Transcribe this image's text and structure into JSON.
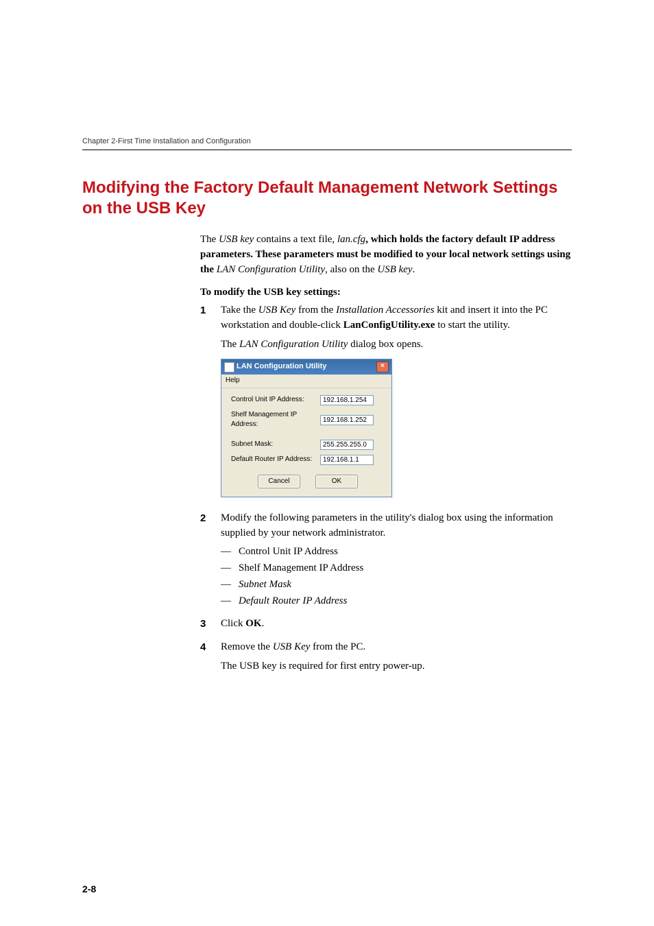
{
  "header": {
    "chapter": "Chapter 2-First Time Installation and Configuration"
  },
  "section": {
    "title": "Modifying the Factory Default Management Network Settings on the USB Key"
  },
  "intro": {
    "p1a": "The ",
    "p1b": "USB key",
    "p1c": " contains a text file, ",
    "p1d": "lan.cfg",
    "p1e": ", which holds the factory default IP address parameters. These parameters must be modified to your local network settings using the ",
    "p1f": "LAN Configuration Utility",
    "p1g": ", also on the ",
    "p1h": "USB key",
    "p1i": "."
  },
  "subhead": "To modify the USB key settings:",
  "steps": {
    "s1": {
      "num": "1",
      "a": "Take the ",
      "b": "USB Key",
      "c": " from the ",
      "d": "Installation Accessories",
      "e": " kit and insert it into the PC workstation and double-click ",
      "f": "LanConfigUtility.exe",
      "g": " to start the utility.",
      "p2a": "The ",
      "p2b": "LAN Configuration Utility",
      "p2c": " dialog box opens."
    },
    "s2": {
      "num": "2",
      "text": "Modify the following parameters in the utility's dialog box using the information supplied by your network administrator.",
      "items": {
        "a": "Control Unit IP Address",
        "b": "Shelf Management IP Address",
        "c": "Subnet Mask",
        "d": "Default Router IP Address"
      }
    },
    "s3": {
      "num": "3",
      "a": "Click ",
      "b": "OK",
      "c": "."
    },
    "s4": {
      "num": "4",
      "a": "Remove the ",
      "b": "USB Key",
      "c": " from the PC.",
      "p2": "The USB key is required for first entry power-up."
    }
  },
  "dialog": {
    "title": "LAN Configuration Utility",
    "menu": "Help",
    "labels": {
      "control": "Control Unit IP Address:",
      "shelf": "Shelf Management IP Address:",
      "subnet": "Subnet Mask:",
      "router": "Default Router IP Address:"
    },
    "values": {
      "control": "192.168.1.254",
      "shelf": "192.168.1.252",
      "subnet": "255.255.255.0",
      "router": "192.168.1.1"
    },
    "buttons": {
      "cancel": "Cancel",
      "ok": "OK"
    }
  },
  "page_number": "2-8"
}
